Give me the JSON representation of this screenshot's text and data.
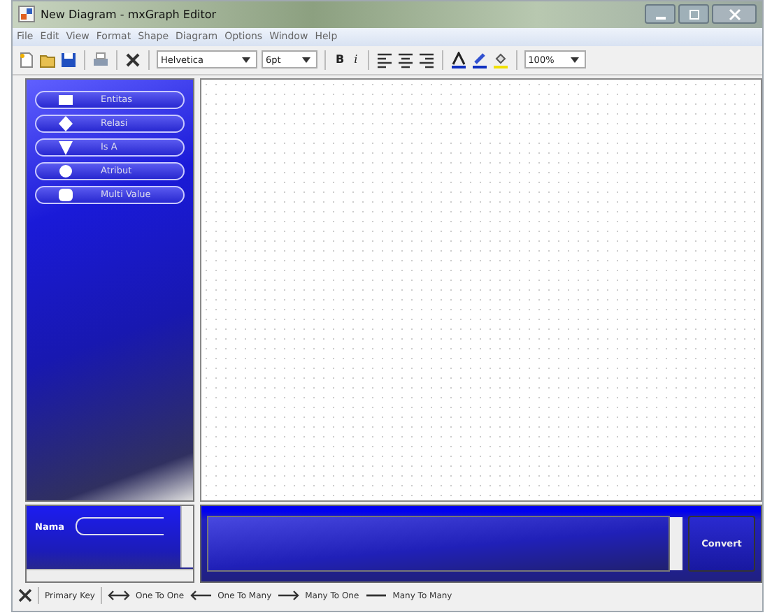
{
  "window": {
    "title": "New Diagram - mxGraph Editor"
  },
  "menu": [
    "File",
    "Edit",
    "View",
    "Format",
    "Shape",
    "Diagram",
    "Options",
    "Window",
    "Help"
  ],
  "toolbar": {
    "font": "Helvetica",
    "size": "6pt",
    "bold": "B",
    "italic": "i",
    "zoom": "100%"
  },
  "palette": [
    {
      "label": "Entitas",
      "kind": "rect"
    },
    {
      "label": "Relasi",
      "kind": "diamond"
    },
    {
      "label": "Is A",
      "kind": "triangle"
    },
    {
      "label": "Atribut",
      "kind": "circle"
    },
    {
      "label": "Multi Value",
      "kind": "rounded"
    }
  ],
  "properties": {
    "label": "Nama"
  },
  "output": {
    "button": "Convert"
  },
  "legend": [
    {
      "label": "Primary Key",
      "kind": "key"
    },
    {
      "label": "One To One",
      "kind": "both"
    },
    {
      "label": "One To Many",
      "kind": "left"
    },
    {
      "label": "Many To One",
      "kind": "right"
    },
    {
      "label": "Many To Many",
      "kind": "line"
    }
  ]
}
